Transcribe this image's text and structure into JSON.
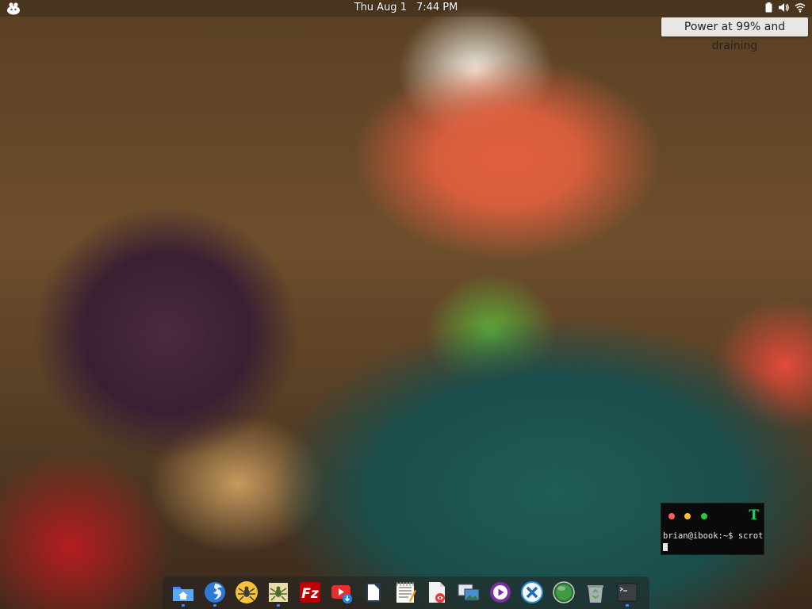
{
  "topbar": {
    "clock_date": "Thu Aug  1",
    "clock_time": "7:44 PM",
    "tray_icons": [
      "battery-icon",
      "volume-icon",
      "wifi-icon"
    ]
  },
  "tooltip": {
    "text": "Power at 99% and draining"
  },
  "terminal": {
    "logo": "T",
    "command_line": "brian@ibook:~$ scrot"
  },
  "dock": {
    "items": [
      "home-folder-icon",
      "browser-icon",
      "spider-game-icon",
      "spider-game-icon-2",
      "filezilla-icon",
      "video-downloader-icon",
      "document-viewer-icon",
      "text-editor-icon",
      "document-viewer-icon-2",
      "image-viewer-icon",
      "media-player-icon",
      "remote-desktop-icon",
      "green-orb-icon",
      "trash-icon",
      "terminal-icon"
    ]
  },
  "colors": {
    "accent_blue": "#3a8fff",
    "terminal_green": "#10d85a"
  }
}
